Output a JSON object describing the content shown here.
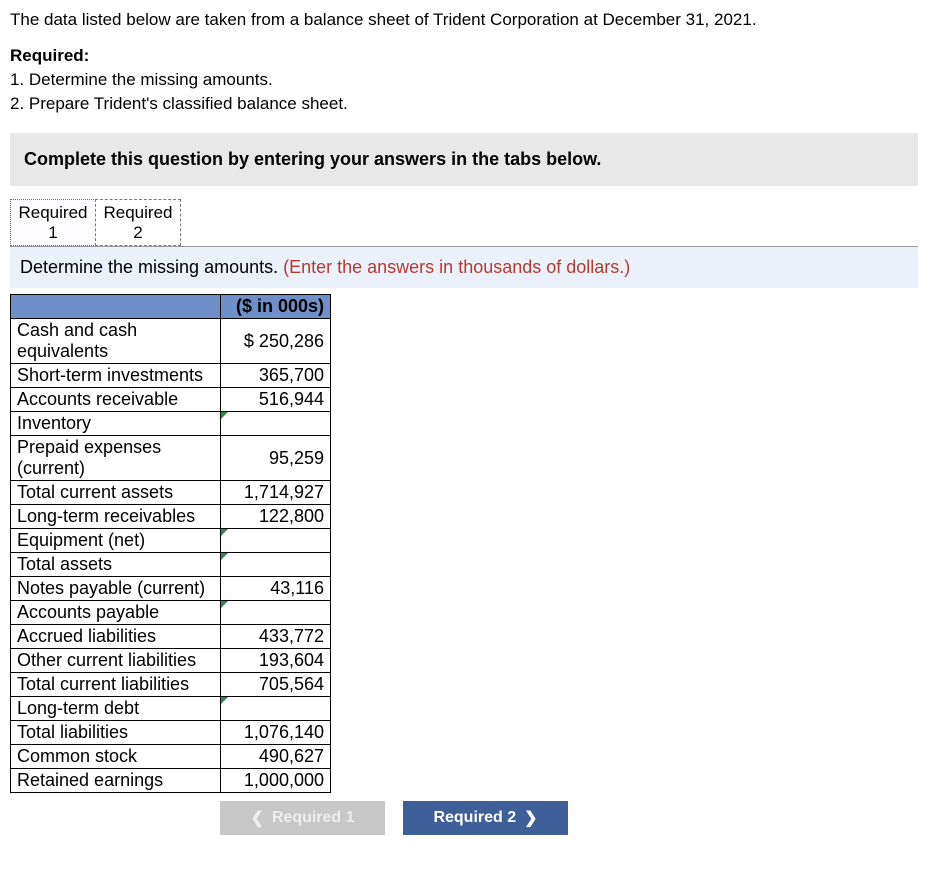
{
  "intro": "The data listed below are taken from a balance sheet of Trident Corporation at December 31, 2021.",
  "required_heading": "Required:",
  "required_items": [
    "1. Determine the missing amounts.",
    "2. Prepare Trident's classified balance sheet."
  ],
  "complete_box": "Complete this question by entering your answers in the tabs below.",
  "tabs": [
    {
      "label": "Required 1",
      "active": true
    },
    {
      "label": "Required 2",
      "active": false
    }
  ],
  "instruction_plain": "Determine the missing amounts. ",
  "instruction_red": "(Enter the answers in thousands of dollars.)",
  "header_value": "($ in 000s)",
  "rows": [
    {
      "label": "Cash and cash equivalents",
      "value": "$  250,286",
      "input": false
    },
    {
      "label": "Short-term investments",
      "value": "365,700",
      "input": false
    },
    {
      "label": "Accounts receivable",
      "value": "516,944",
      "input": false
    },
    {
      "label": "Inventory",
      "value": "",
      "input": true
    },
    {
      "label": "Prepaid expenses (current)",
      "value": "95,259",
      "input": false
    },
    {
      "label": "Total current assets",
      "value": "1,714,927",
      "input": false
    },
    {
      "label": "Long-term receivables",
      "value": "122,800",
      "input": false
    },
    {
      "label": "Equipment (net)",
      "value": "",
      "input": true
    },
    {
      "label": "Total assets",
      "value": "",
      "input": true
    },
    {
      "label": "Notes payable (current)",
      "value": "43,116",
      "input": false
    },
    {
      "label": "Accounts payable",
      "value": "",
      "input": true
    },
    {
      "label": "Accrued liabilities",
      "value": "433,772",
      "input": false
    },
    {
      "label": "Other current liabilities",
      "value": "193,604",
      "input": false
    },
    {
      "label": "Total current liabilities",
      "value": "705,564",
      "input": false
    },
    {
      "label": "Long-term debt",
      "value": "",
      "input": true
    },
    {
      "label": "Total liabilities",
      "value": "1,076,140",
      "input": false
    },
    {
      "label": "Common stock",
      "value": "490,627",
      "input": false
    },
    {
      "label": "Retained earnings",
      "value": "1,000,000",
      "input": false
    }
  ],
  "nav": {
    "prev": "Required 1",
    "next": "Required 2"
  }
}
